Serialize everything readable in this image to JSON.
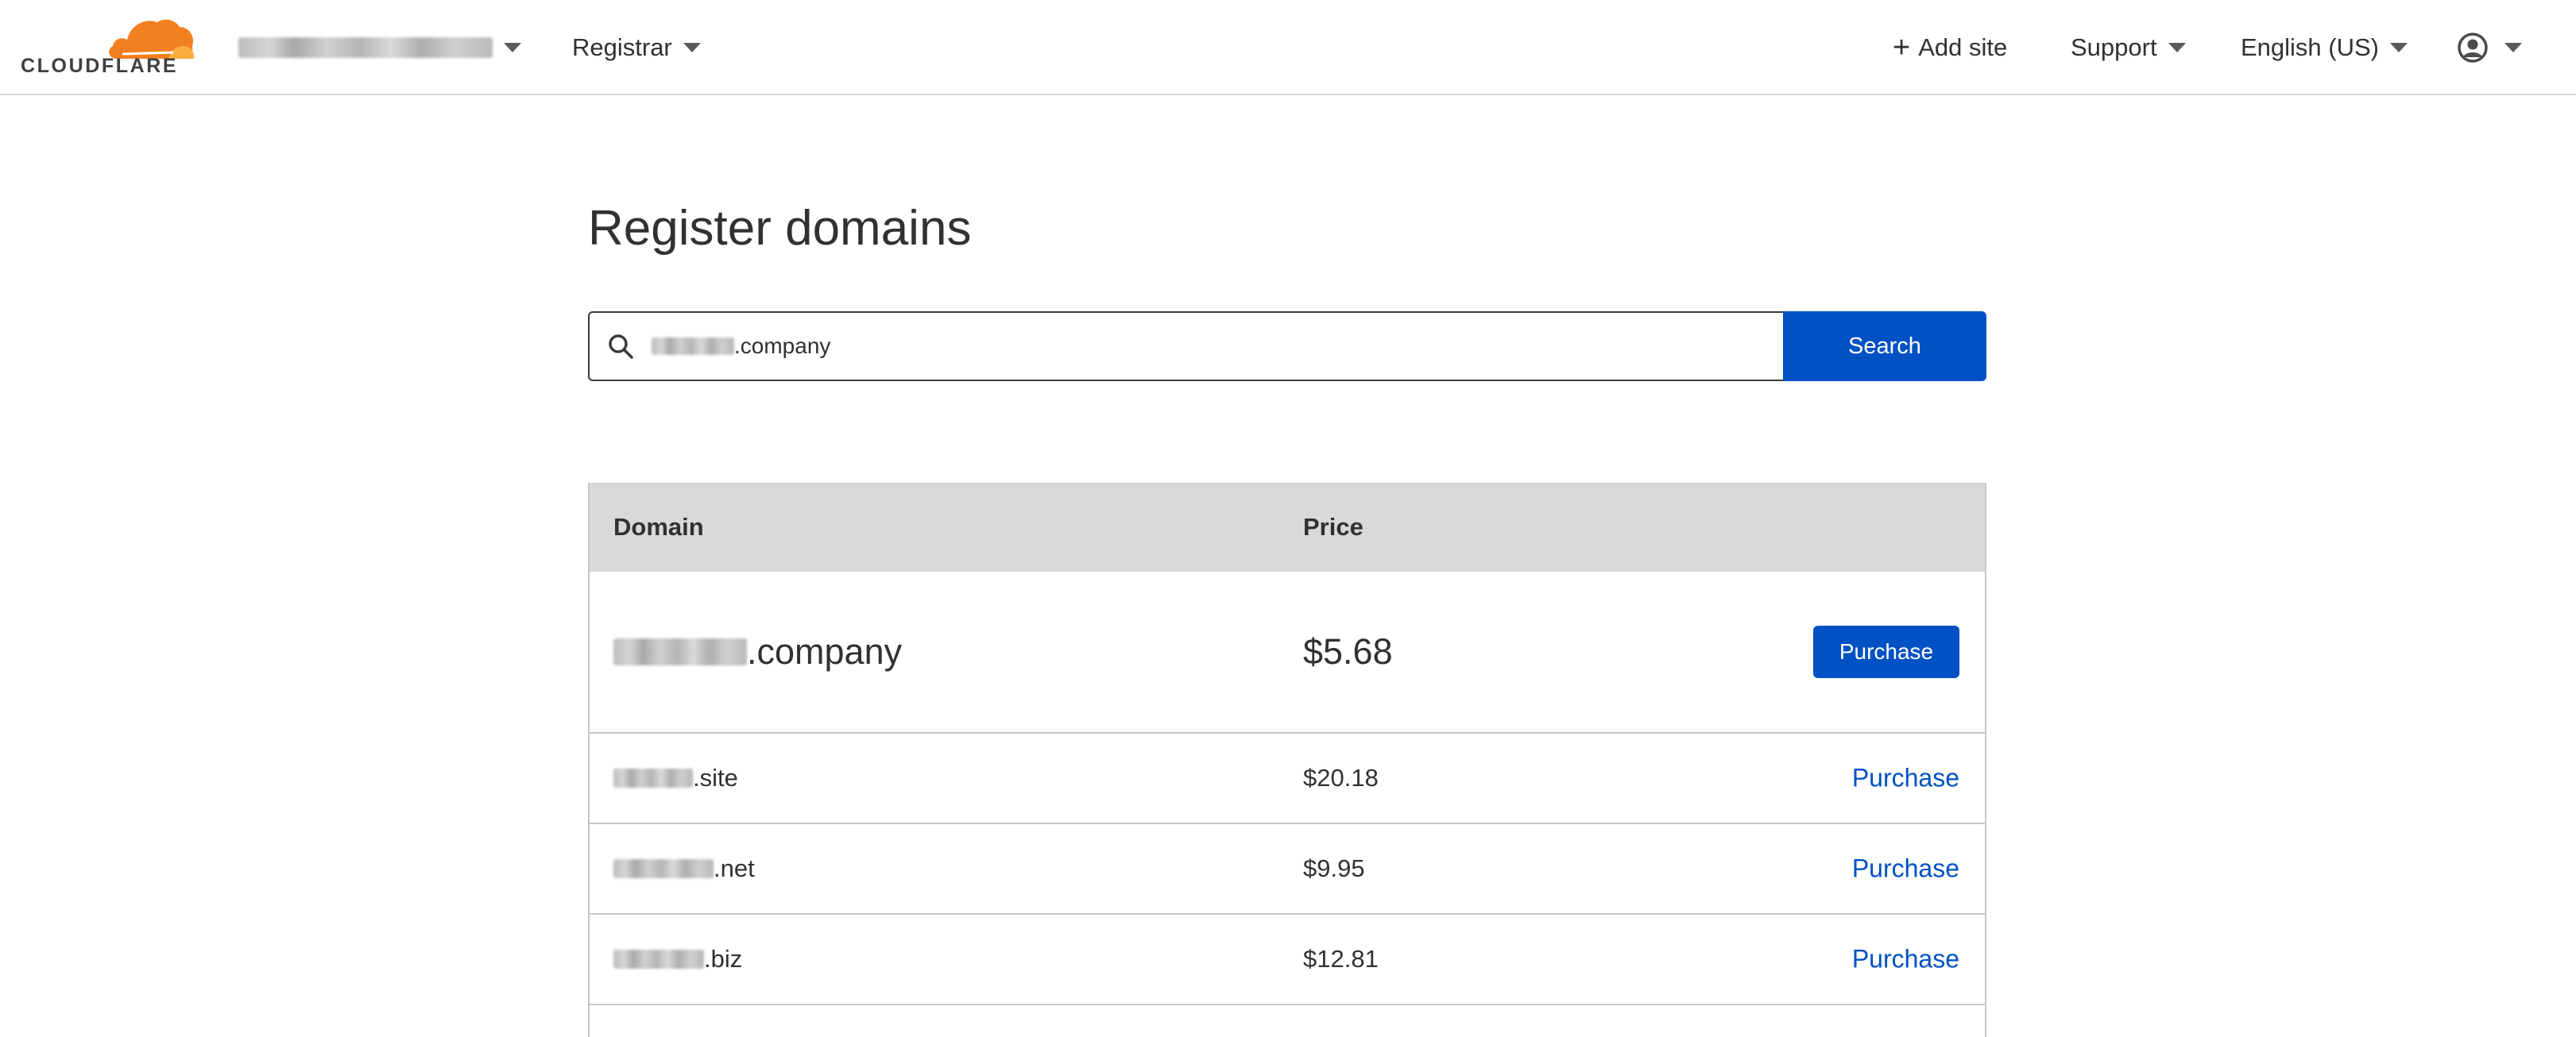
{
  "brand": {
    "wordmark": "CLOUDFLARE",
    "orange": "#f38020",
    "light_orange": "#faae40"
  },
  "nav": {
    "account_label": "",
    "registrar_label": "Registrar",
    "add_site_label": "Add site",
    "support_label": "Support",
    "language_label": "English (US)"
  },
  "page": {
    "title": "Register domains"
  },
  "search": {
    "query_suffix": ".company",
    "button_label": "Search"
  },
  "table": {
    "headers": {
      "domain": "Domain",
      "price": "Price"
    },
    "featured": {
      "tld": ".company",
      "price": "$5.68",
      "action": "Purchase"
    },
    "rows": [
      {
        "tld": ".site",
        "price": "$20.18",
        "action": "Purchase"
      },
      {
        "tld": ".net",
        "price": "$9.95",
        "action": "Purchase"
      },
      {
        "tld": ".biz",
        "price": "$12.81",
        "action": "Purchase"
      }
    ]
  },
  "colors": {
    "primary": "#0051c3",
    "header_bg": "#d9d9d9",
    "text": "#313131"
  }
}
